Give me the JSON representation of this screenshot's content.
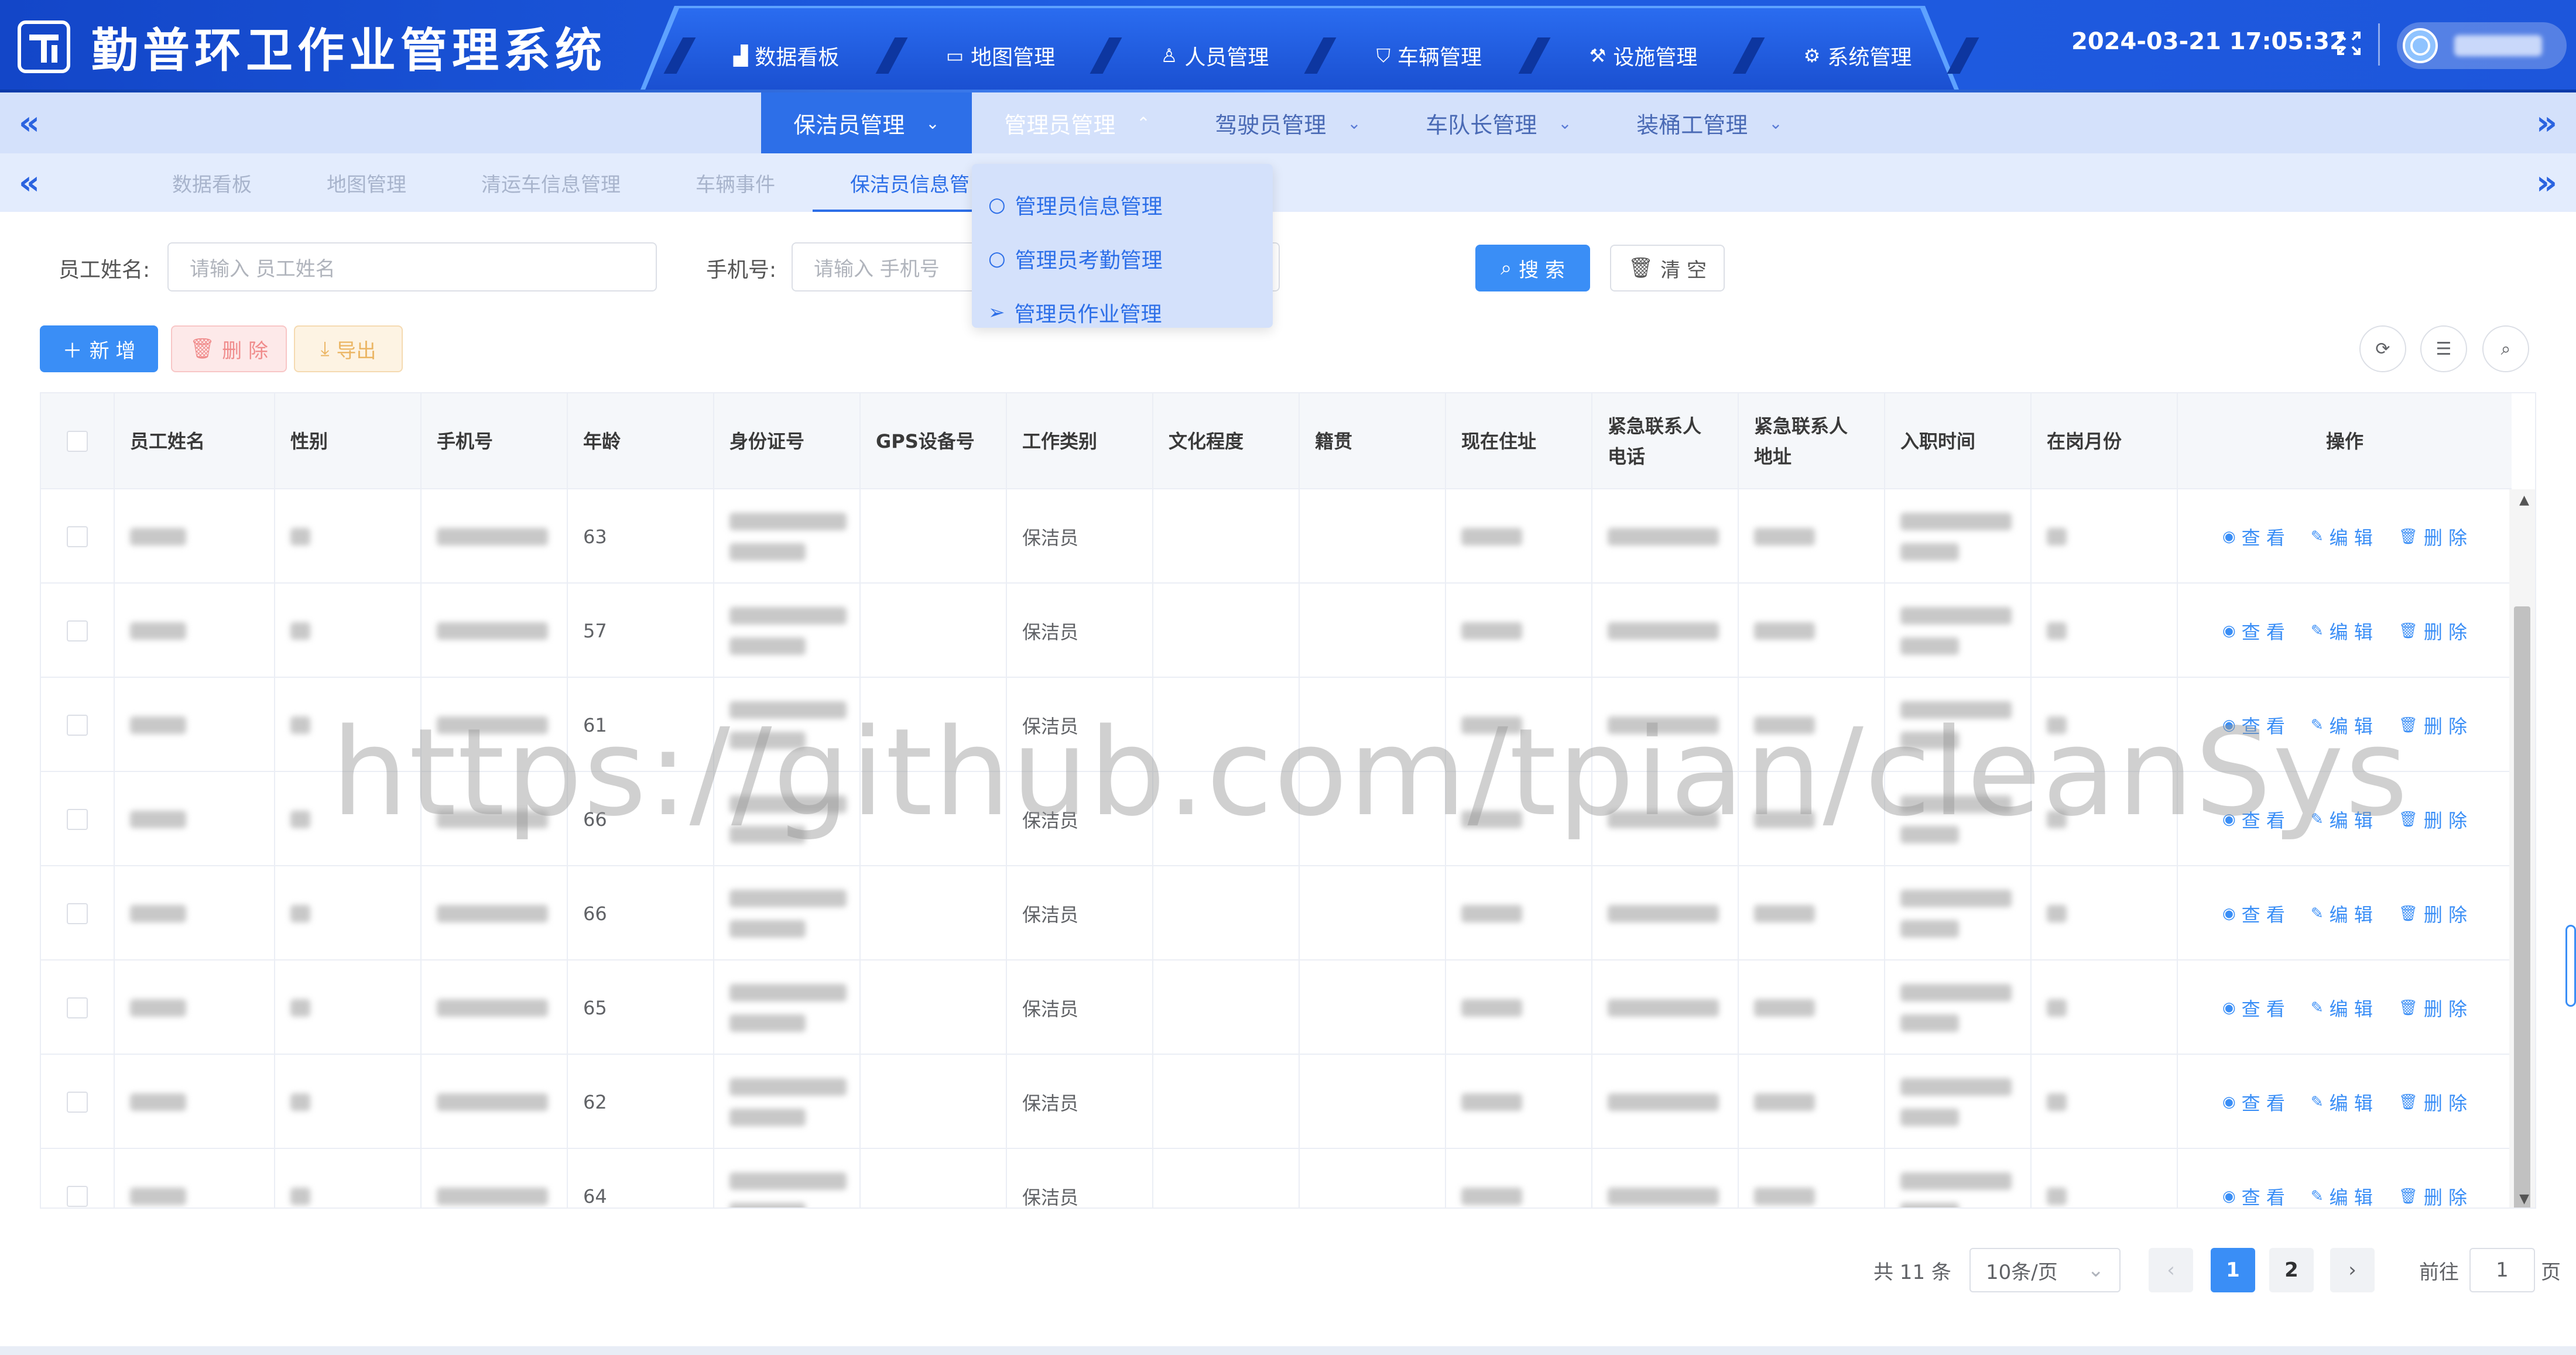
{
  "header": {
    "title": "勤普环卫作业管理系统",
    "nav": [
      {
        "label": "数据看板",
        "icon": "bar-chart-icon"
      },
      {
        "label": "地图管理",
        "icon": "monitor-icon"
      },
      {
        "label": "人员管理",
        "icon": "user-icon"
      },
      {
        "label": "车辆管理",
        "icon": "shield-icon"
      },
      {
        "label": "设施管理",
        "icon": "wrench-icon"
      },
      {
        "label": "系统管理",
        "icon": "gear-icon"
      }
    ],
    "datetime": "2024-03-21 17:05:32"
  },
  "subnav": {
    "items": [
      {
        "label": "保洁员管理",
        "state": "active"
      },
      {
        "label": "管理员管理",
        "state": "hover"
      },
      {
        "label": "驾驶员管理",
        "state": "normal"
      },
      {
        "label": "车队长管理",
        "state": "normal"
      },
      {
        "label": "装桶工管理",
        "state": "normal"
      }
    ]
  },
  "tabs": [
    {
      "label": "数据看板"
    },
    {
      "label": "地图管理"
    },
    {
      "label": "清运车信息管理"
    },
    {
      "label": "车辆事件"
    },
    {
      "label": "保洁员信息管"
    }
  ],
  "dropdown": {
    "items": [
      {
        "label": "管理员信息管理",
        "icon": "chat-circle-icon"
      },
      {
        "label": "管理员考勤管理",
        "icon": "chat-circle-icon"
      },
      {
        "label": "管理员作业管理",
        "icon": "send-icon"
      }
    ]
  },
  "search": {
    "name_label": "员工姓名:",
    "name_placeholder": "请输入 员工姓名",
    "phone_label": "手机号:",
    "phone_placeholder": "请输入 手机号",
    "search_btn": "搜 索",
    "clear_btn": "清 空"
  },
  "toolbar": {
    "add": "新 增",
    "delete": "删 除",
    "export": "导出"
  },
  "table": {
    "columns": [
      "员工姓名",
      "性别",
      "手机号",
      "年龄",
      "身份证号",
      "GPS设备号",
      "工作类别",
      "文化程度",
      "籍贯",
      "现在住址",
      "紧急联系人电话",
      "紧急联系人地址",
      "入职时间",
      "在岗月份",
      "操作"
    ],
    "rows": [
      {
        "age": "63",
        "category": "保洁员"
      },
      {
        "age": "57",
        "category": "保洁员"
      },
      {
        "age": "61",
        "category": "保洁员"
      },
      {
        "age": "66",
        "category": "保洁员"
      },
      {
        "age": "66",
        "category": "保洁员"
      },
      {
        "age": "65",
        "category": "保洁员"
      },
      {
        "age": "62",
        "category": "保洁员"
      },
      {
        "age": "64",
        "category": "保洁员"
      }
    ],
    "ops": {
      "view": "查 看",
      "edit": "编 辑",
      "delete": "删 除"
    }
  },
  "pagination": {
    "total": "共 11 条",
    "page_size": "10条/页",
    "pages": [
      "1",
      "2"
    ],
    "current": "1",
    "goto_label": "前往",
    "goto_value": "1",
    "page_suffix": "页"
  },
  "watermark": "https://github.com/tpian/cleanSys",
  "colors": {
    "primary": "#2d6fe8",
    "header": "#1f5fe4",
    "button": "#3a8ef6"
  }
}
